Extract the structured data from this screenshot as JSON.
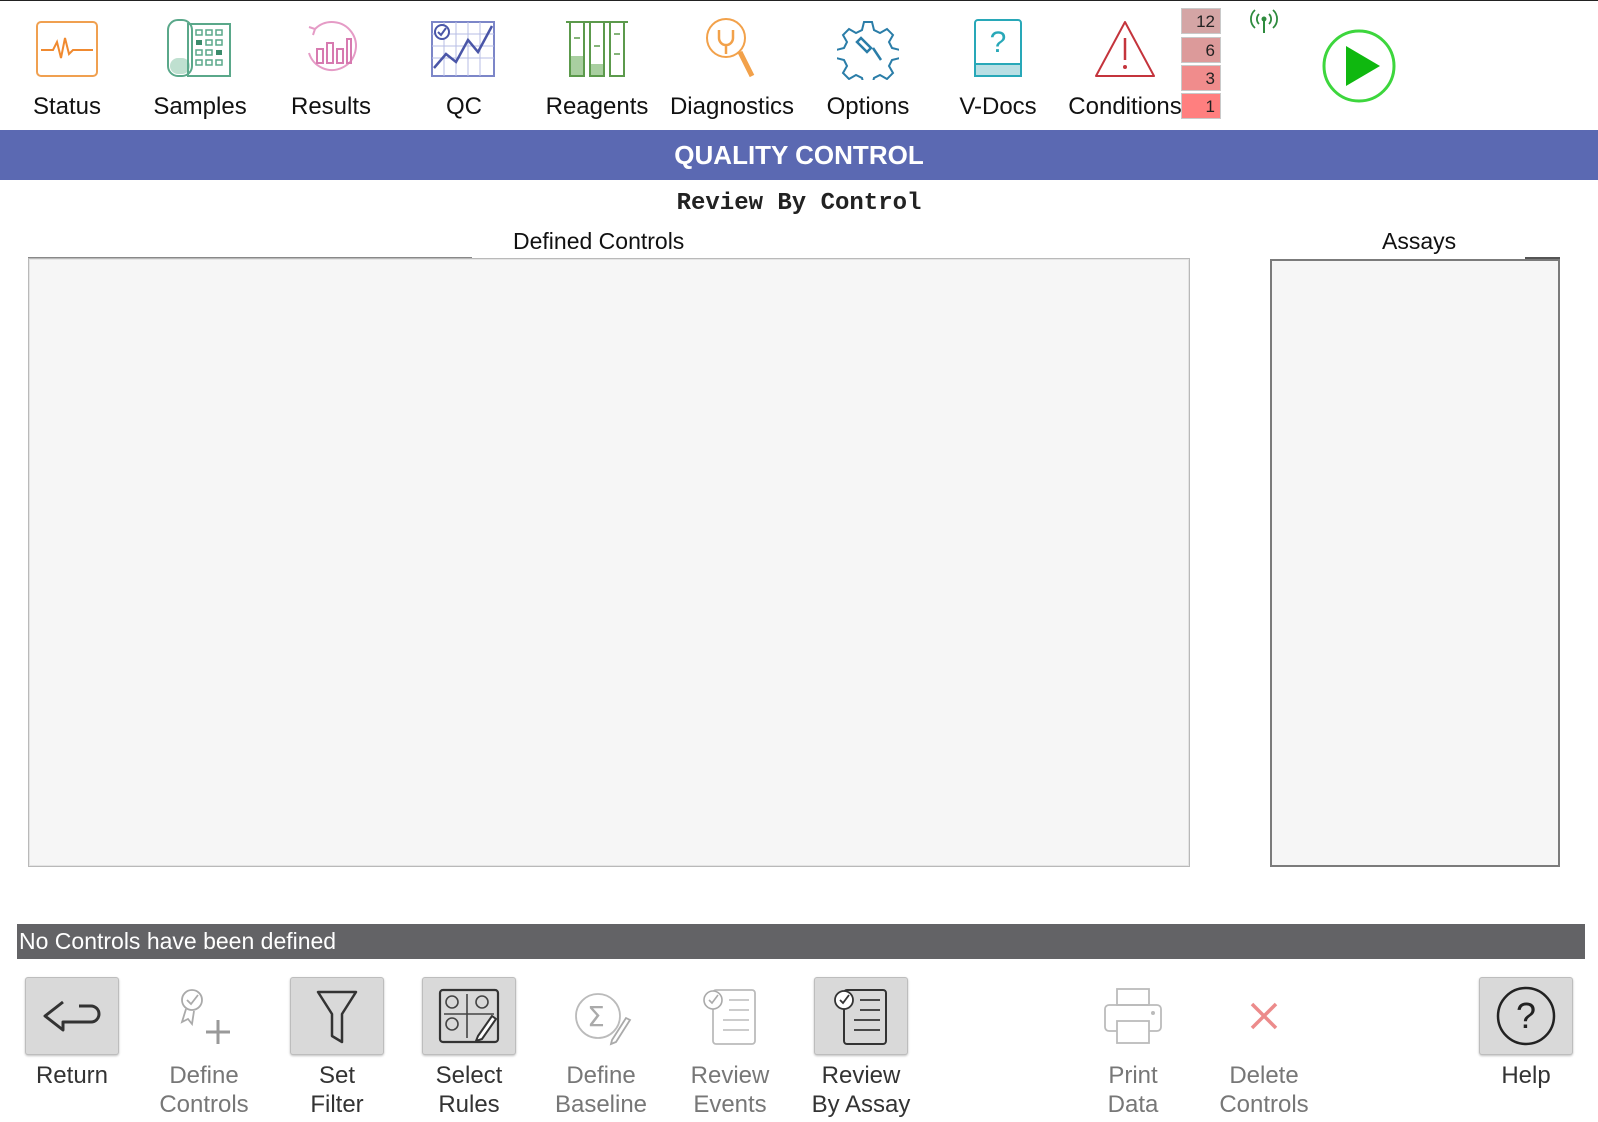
{
  "nav": {
    "items": [
      {
        "label": "Status",
        "icon": "status-waveform-icon"
      },
      {
        "label": "Samples",
        "icon": "samples-rack-icon"
      },
      {
        "label": "Results",
        "icon": "results-chart-icon"
      },
      {
        "label": "QC",
        "icon": "qc-chart-icon"
      },
      {
        "label": "Reagents",
        "icon": "reagents-tubes-icon"
      },
      {
        "label": "Diagnostics",
        "icon": "diagnostics-wrench-icon"
      },
      {
        "label": "Options",
        "icon": "options-gear-icon"
      },
      {
        "label": "V-Docs",
        "icon": "vdocs-book-icon"
      },
      {
        "label": "Conditions",
        "icon": "conditions-warning-icon"
      }
    ],
    "counters": [
      "12",
      "6",
      "3",
      "1"
    ],
    "counter_colors": [
      "#d4a5a5",
      "#dc9a9a",
      "#f08c8c",
      "#ff7f7f"
    ],
    "run_icon": "play-icon",
    "signal_icon": "wireless-signal-icon"
  },
  "page": {
    "section_title": "QUALITY CONTROL",
    "subtitle": "Review By Control",
    "defined_controls_title": "Defined Controls",
    "assays_title": "Assays",
    "status_message": "No Controls have been defined",
    "banner_color": "#5b69b2"
  },
  "toolbar": {
    "items": [
      {
        "label": "Return",
        "icon": "return-arrow-icon",
        "enabled": true
      },
      {
        "label": "Define\nControls",
        "icon": "define-controls-icon",
        "enabled": false
      },
      {
        "label": "Set\nFilter",
        "icon": "filter-funnel-icon",
        "enabled": true
      },
      {
        "label": "Select\nRules",
        "icon": "select-rules-icon",
        "enabled": true
      },
      {
        "label": "Define\nBaseline",
        "icon": "define-baseline-icon",
        "enabled": false
      },
      {
        "label": "Review\nEvents",
        "icon": "review-events-icon",
        "enabled": false
      },
      {
        "label": "Review\nBy Assay",
        "icon": "review-by-assay-icon",
        "enabled": true
      },
      {
        "label": "Print\nData",
        "icon": "printer-icon",
        "enabled": false
      },
      {
        "label": "Delete\nControls",
        "icon": "delete-x-icon",
        "enabled": false
      },
      {
        "label": "Help",
        "icon": "help-question-icon",
        "enabled": true
      }
    ]
  }
}
